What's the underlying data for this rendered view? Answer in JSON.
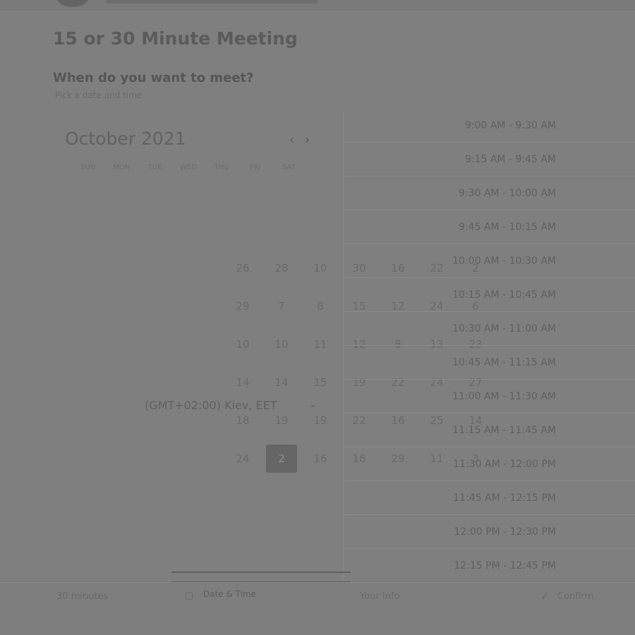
{
  "header": {
    "title": "15 or 30 Minute Meeting",
    "subtitle": "When do you want to meet?",
    "helper": "Pick a date and time"
  },
  "calendar": {
    "month": "October 2021",
    "prev_icon": "chevron-left-icon",
    "next_icon": "chevron-right-icon",
    "weekdays": [
      "SUN",
      "MON",
      "TUE",
      "WED",
      "THU",
      "FRI",
      "SAT"
    ],
    "days": [
      [
        "26",
        "28",
        "10",
        "30",
        "16",
        "22",
        "2"
      ],
      [
        "29",
        "7",
        "8",
        "15",
        "12",
        "24",
        "6"
      ],
      [
        "10",
        "10",
        "11",
        "12",
        "8",
        "13",
        "23"
      ],
      [
        "14",
        "14",
        "15",
        "19",
        "22",
        "24",
        "27"
      ],
      [
        "18",
        "19",
        "19",
        "22",
        "16",
        "25",
        "14"
      ],
      [
        "24",
        "2",
        "16",
        "16",
        "29",
        "11",
        "3"
      ]
    ],
    "selected_day": "2",
    "timezone": "(GMT+02:00) Kiev, EET"
  },
  "time_slots": [
    "9:00 AM - 9:30 AM",
    "9:15 AM - 9:45 AM",
    "9:30 AM - 10:00 AM",
    "9:45 AM - 10:15 AM",
    "10:00 AM - 10:30 AM",
    "10:15 AM - 10:45 AM",
    "10:30 AM - 11:00 AM",
    "10:45 AM - 11:15 AM",
    "11:00 AM - 11:30 AM",
    "11:15 AM - 11:45 AM",
    "11:30 AM - 12:00 PM",
    "11:45 AM - 12:15 PM",
    "12:00 PM - 12:30 PM",
    "12:15 PM - 12:45 PM"
  ],
  "footer": {
    "duration": "30 minutes",
    "date_time": "Date & Time",
    "middle": "Your Info",
    "right": "Confirm"
  }
}
